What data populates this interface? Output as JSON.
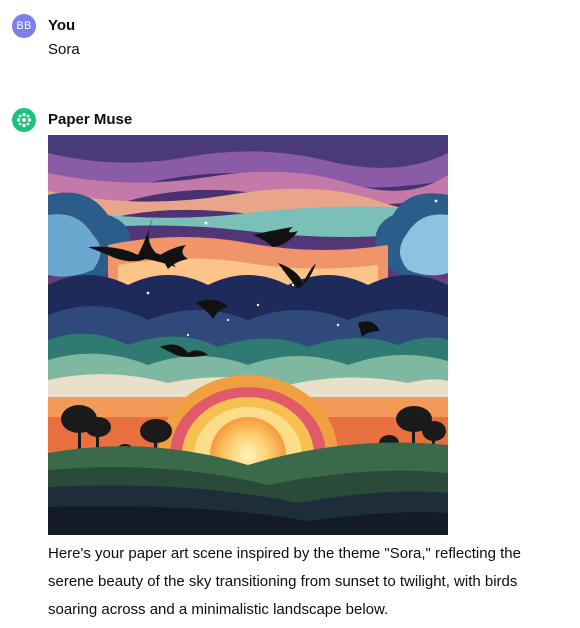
{
  "user": {
    "initials": "BB",
    "name": "You",
    "message": "Sora"
  },
  "assistant": {
    "name": "Paper Muse",
    "response": "Here's your paper art scene inspired by the theme \"Sora,\" reflecting the serene beauty of the sky transitioning from sunset to twilight, with birds soaring across and a minimalistic landscape below."
  },
  "colors": {
    "user_avatar": "#7b7fe8",
    "assistant_avatar": "#19c37d"
  }
}
